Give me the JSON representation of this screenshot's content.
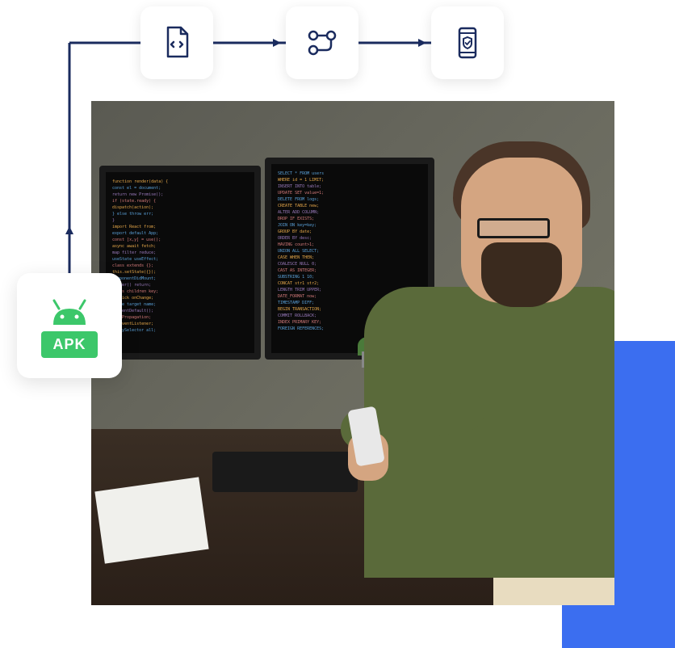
{
  "flow": {
    "start_card": {
      "icon_name": "android-apk-icon",
      "label": "APK"
    },
    "steps": [
      {
        "icon_name": "code-file-icon"
      },
      {
        "icon_name": "pipeline-icon"
      },
      {
        "icon_name": "mobile-shield-icon"
      }
    ]
  },
  "colors": {
    "connector": "#1a2b5e",
    "apk_green": "#3cc76a",
    "accent_blue": "#3b6ef0"
  },
  "photo": {
    "description": "Developer at desk with dual monitors showing code, holding smartphone"
  }
}
